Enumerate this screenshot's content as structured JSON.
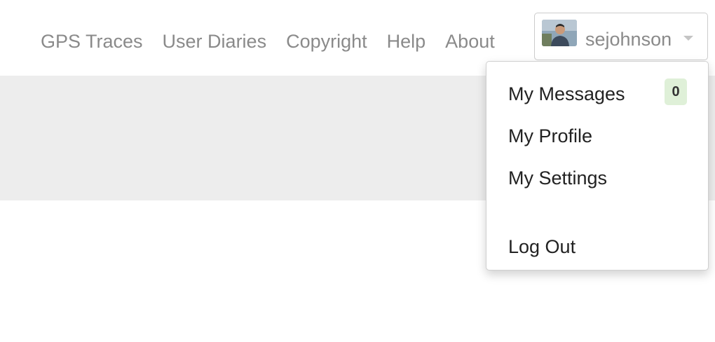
{
  "nav": {
    "links": [
      {
        "label": "GPS Traces"
      },
      {
        "label": "User Diaries"
      },
      {
        "label": "Copyright"
      },
      {
        "label": "Help"
      },
      {
        "label": "About"
      }
    ]
  },
  "user_menu": {
    "username": "sejohnson",
    "avatar_icon": "user-avatar-photo",
    "caret_icon": "chevron-down-icon",
    "items": [
      {
        "label": "My Messages",
        "badge": "0"
      },
      {
        "label": "My Profile"
      },
      {
        "label": "My Settings"
      },
      {
        "label": "Log Out"
      }
    ]
  },
  "colors": {
    "nav_text": "#8a8a8a",
    "menu_text": "#222222",
    "band": "#ededed",
    "badge_bg": "#dff0d8"
  }
}
